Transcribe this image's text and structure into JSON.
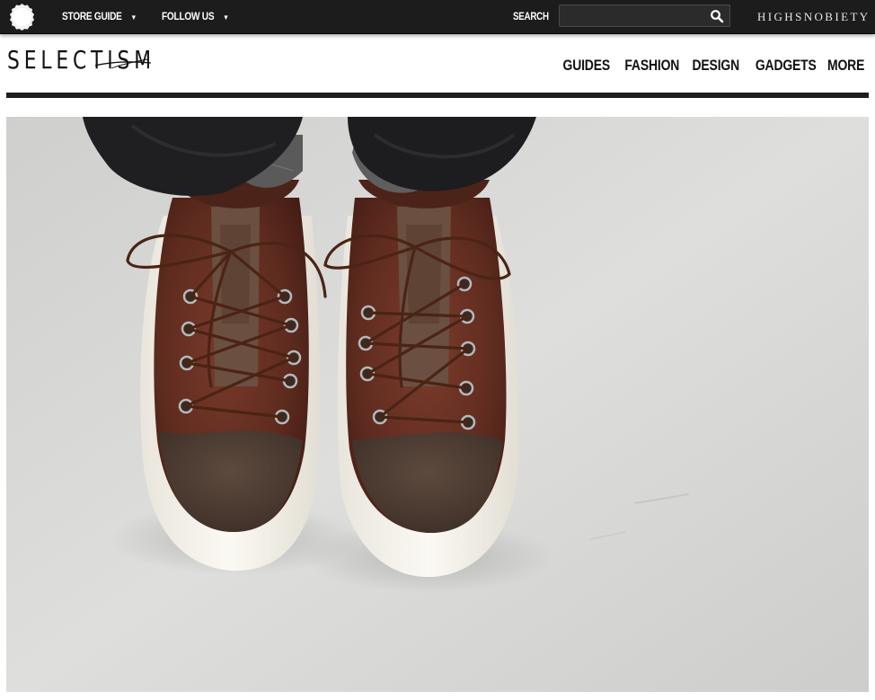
{
  "topbar": {
    "store_guide": "STORE GUIDE",
    "follow_us": "FOLLOW US",
    "caret": "▼",
    "search_label": "SEARCH",
    "search_value": "",
    "partner_logo": "HIGHSNOBIETY",
    "badge_icon": "seal-badge-icon",
    "search_icon": "magnifier-icon"
  },
  "header": {
    "brand": "SELECTISM",
    "nav": [
      "GUIDES",
      "FASHION",
      "DESIGN",
      "GADGETS",
      "MORE"
    ]
  },
  "hero": {
    "subject": "top-down photo of brown leather sneakers with suede toe caps"
  },
  "colors": {
    "topbar_bg": "#1c1c1c",
    "text_dark": "#111111",
    "rule": "#1e1e1e",
    "leather": "#5a2a1e",
    "suede": "#4b3a30",
    "sole": "#f4f1ea",
    "floor": "#d6d6d4"
  }
}
